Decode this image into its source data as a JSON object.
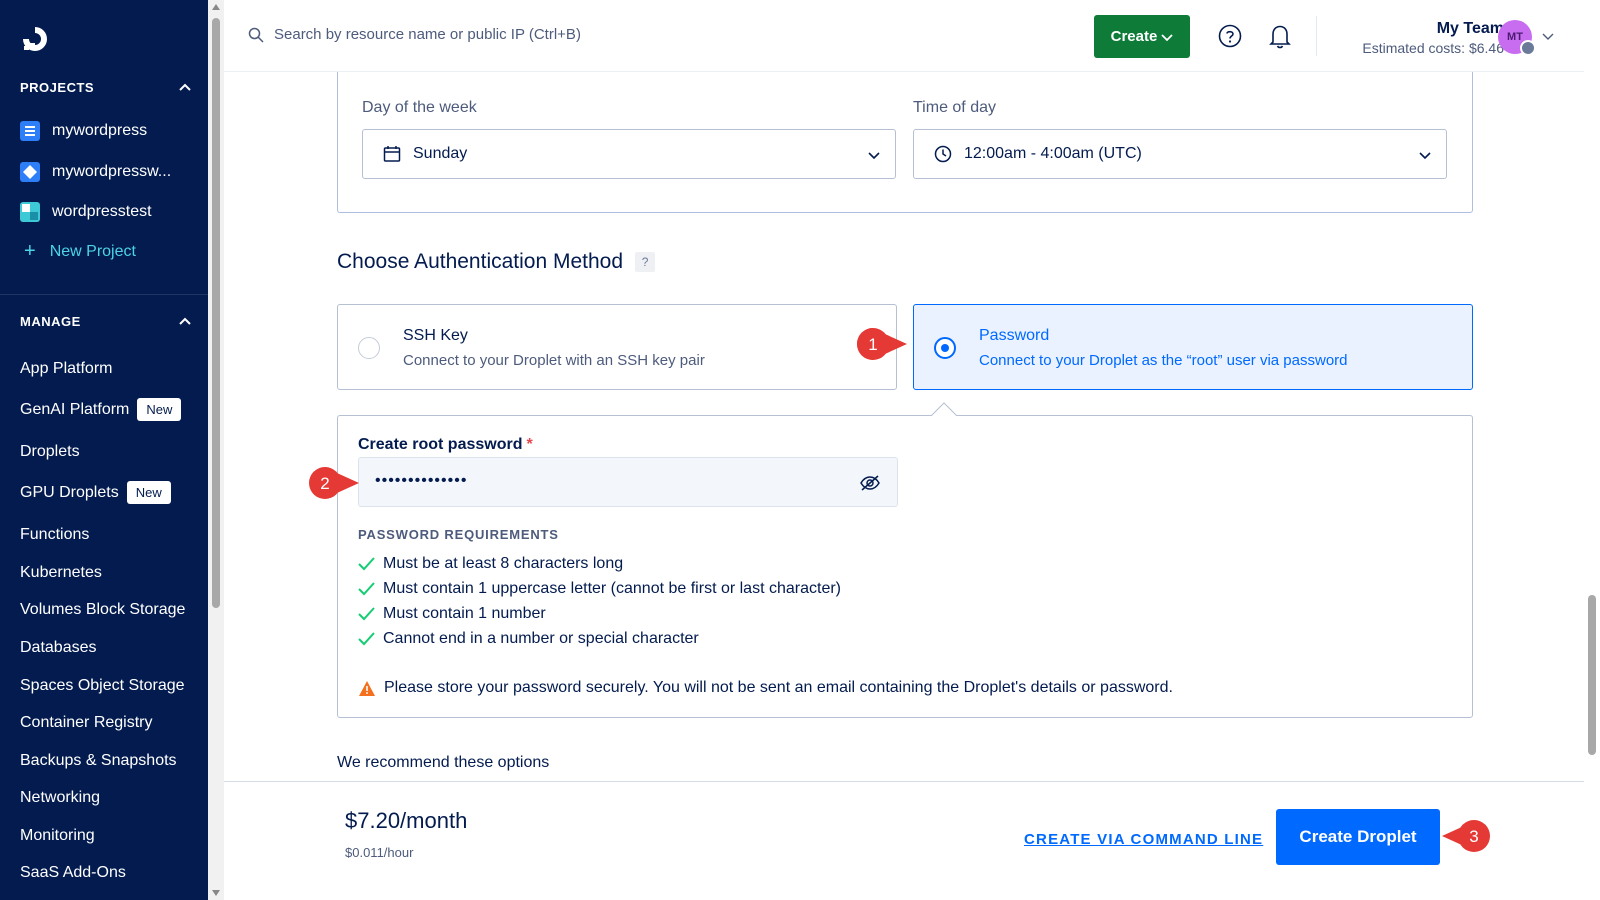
{
  "sidebar": {
    "projects_heading": "PROJECTS",
    "projects": [
      {
        "label": "mywordpress",
        "color": "#2d7ef7"
      },
      {
        "label": "mywordpressw...",
        "color": "#2d7ef7"
      },
      {
        "label": "wordpresstest",
        "color": "#3dc9d6"
      }
    ],
    "new_project_label": "New Project",
    "manage_heading": "MANAGE",
    "nav": [
      {
        "label": "App Platform"
      },
      {
        "label": "GenAI Platform",
        "badge": "New"
      },
      {
        "label": "Droplets"
      },
      {
        "label": "GPU Droplets",
        "badge": "New"
      },
      {
        "label": "Functions"
      },
      {
        "label": "Kubernetes"
      },
      {
        "label": "Volumes Block Storage"
      },
      {
        "label": "Databases"
      },
      {
        "label": "Spaces Object Storage"
      },
      {
        "label": "Container Registry"
      },
      {
        "label": "Backups & Snapshots"
      },
      {
        "label": "Networking"
      },
      {
        "label": "Monitoring"
      },
      {
        "label": "SaaS Add-Ons"
      }
    ]
  },
  "topbar": {
    "search_placeholder": "Search by resource name or public IP (Ctrl+B)",
    "create_label": "Create",
    "team_name": "My Team",
    "estimated_costs": "Estimated costs: $6.46",
    "avatar_initials": "MT"
  },
  "maintenance": {
    "day_label": "Day of the week",
    "day_value": "Sunday",
    "time_label": "Time of day",
    "time_value": "12:00am - 4:00am (UTC)"
  },
  "auth": {
    "title": "Choose Authentication Method",
    "help": "?",
    "options": [
      {
        "title": "SSH Key",
        "subtitle": "Connect to your Droplet with an SSH key pair",
        "selected": false
      },
      {
        "title": "Password",
        "subtitle": "Connect to your Droplet as the “root” user via password",
        "selected": true
      }
    ],
    "password_label": "Create root password",
    "required_mark": "*",
    "password_value": "••••••••••••••",
    "requirements_heading": "PASSWORD REQUIREMENTS",
    "requirements": [
      "Must be at least 8 characters long",
      "Must contain 1 uppercase letter (cannot be first or last character)",
      "Must contain 1 number",
      "Cannot end in a number or special character"
    ],
    "warning": "Please store your password securely. You will not be sent an email containing the Droplet's details or password."
  },
  "recommend_label": "We recommend these options",
  "footer": {
    "price": "$7.20/month",
    "price_hourly": "$0.011/hour",
    "cli_label": "CREATE VIA COMMAND LINE",
    "create_label": "Create Droplet"
  },
  "callouts": [
    "1",
    "2",
    "3"
  ],
  "colors": {
    "sidebar_bg": "#031b4e",
    "accent_blue": "#0069ff",
    "create_green": "#0e7b38",
    "check_green": "#15cd72",
    "warning_orange": "#f5701e",
    "callout_red": "#e53935"
  }
}
